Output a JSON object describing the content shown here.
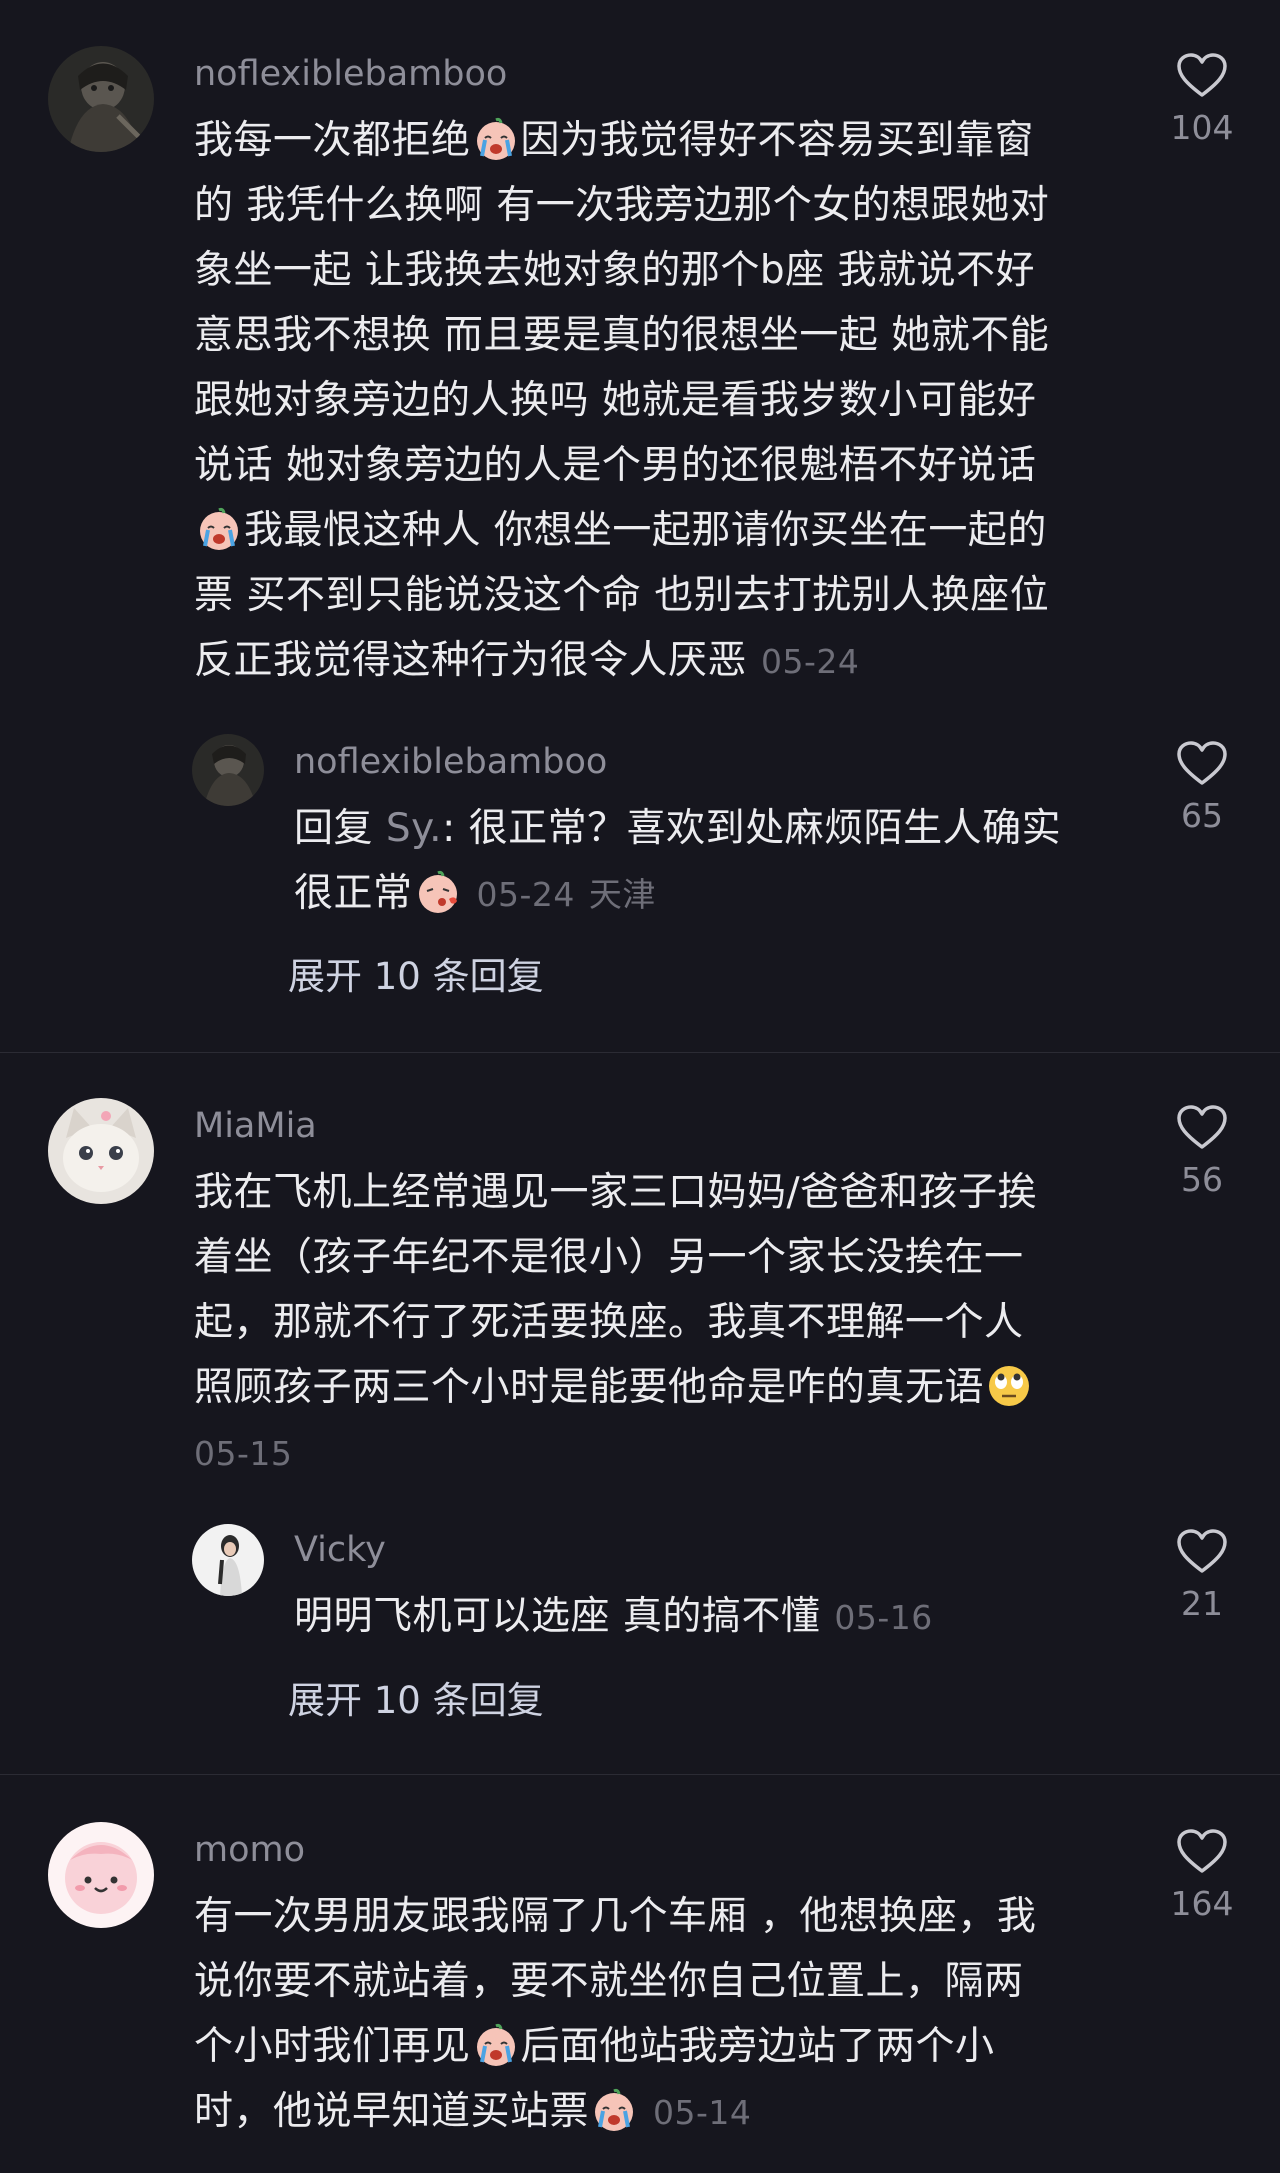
{
  "comments": [
    {
      "username": "noflexiblebamboo",
      "like_count": "104",
      "lines": [
        {
          "a": "我每一次都拒绝",
          "emoji": "crying-face",
          "b": "因为我觉得好不容易买到靠窗"
        },
        {
          "a": "的 我凭什么换啊 有一次我旁边那个女的想跟她对"
        },
        {
          "a": "象坐一起 让我换去她对象的那个b座 我就说不好"
        },
        {
          "a": "意思我不想换 而且要是真的很想坐一起 她就不能"
        },
        {
          "a": "跟她对象旁边的人换吗 她就是看我岁数小可能好"
        },
        {
          "a": "说话 她对象旁边的人是个男的还很魁梧不好说话"
        },
        {
          "emoji": "crying-face",
          "a": "我最恨这种人 你想坐一起那请你买坐在一起的"
        },
        {
          "a": "票 买不到只能说没这个命 也别去打扰别人换座位"
        },
        {
          "a": "反正我觉得这种行为很令人厌恶"
        }
      ],
      "date": "05-24",
      "reply": {
        "username": "noflexiblebamboo",
        "prefix": "回复 ",
        "target": "Sy.",
        "line1": ": 很正常？喜欢到处麻烦陌生人确实",
        "line2": "很正常",
        "emoji": "kissing-face",
        "date": "05-24",
        "location": "天津",
        "like_count": "65"
      },
      "expand_label": "展开 10 条回复"
    },
    {
      "username": "MiaMia",
      "like_count": "56",
      "lines": [
        {
          "a": "我在飞机上经常遇见一家三口妈妈/爸爸和孩子挨"
        },
        {
          "a": "着坐（孩子年纪不是很小）另一个家长没挨在一"
        },
        {
          "a": "起，那就不行了死活要换座。我真不理解一个人"
        },
        {
          "a": "照顾孩子两三个小时是能要他命是咋的真无语",
          "emoji": "eye-roll-face"
        }
      ],
      "date": "05-15",
      "reply": {
        "username": "Vicky",
        "text": "明明飞机可以选座 真的搞不懂",
        "date": "05-16",
        "like_count": "21"
      },
      "expand_label": "展开 10 条回复"
    },
    {
      "username": "momo",
      "like_count": "164",
      "lines": [
        {
          "a": "有一次男朋友跟我隔了几个车厢 ，他想换座，我"
        },
        {
          "a": "说你要不就站着，要不就坐你自己位置上，隔两"
        },
        {
          "a": "个小时我们再见",
          "emoji": "crying-face",
          "b": "后面他站我旁边站了两个小"
        },
        {
          "a": "时，他说早知道买站票",
          "emoji": "crying-face"
        }
      ],
      "date": "05-14"
    }
  ],
  "colors": {
    "background": "#16161e",
    "text": "#ececef",
    "muted": "#8e8e99",
    "expand": "#cfd3e2"
  }
}
